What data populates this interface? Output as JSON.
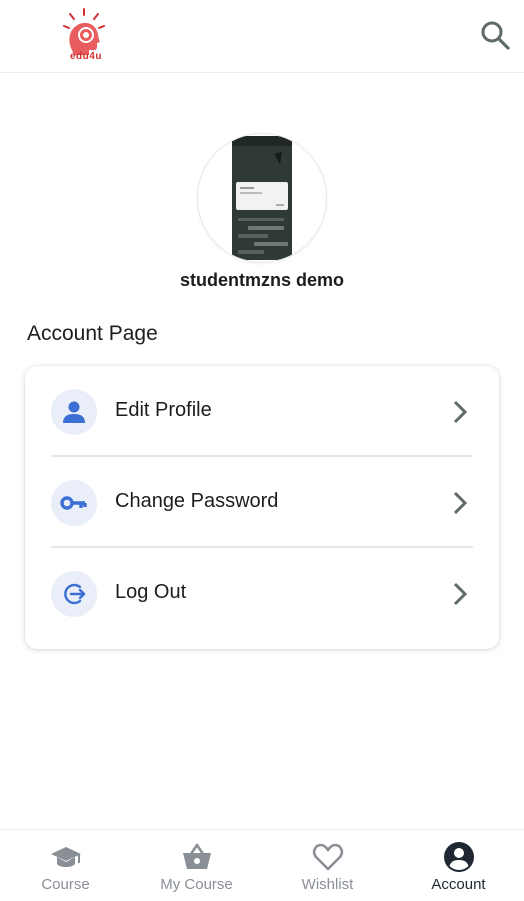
{
  "header": {
    "logo_text": "edu4u",
    "search_icon": "search-icon"
  },
  "profile": {
    "name": "studentmzns demo"
  },
  "section_title": "Account Page",
  "menu": [
    {
      "label": "Edit Profile",
      "icon": "person-icon"
    },
    {
      "label": "Change Password",
      "icon": "key-icon"
    },
    {
      "label": "Log Out",
      "icon": "logout-icon"
    }
  ],
  "bottom_nav": [
    {
      "label": "Course",
      "icon": "graduation-cap-icon",
      "active": false
    },
    {
      "label": "My Course",
      "icon": "basket-icon",
      "active": false
    },
    {
      "label": "Wishlist",
      "icon": "heart-icon",
      "active": false
    },
    {
      "label": "Account",
      "icon": "account-circle-icon",
      "active": true
    }
  ],
  "colors": {
    "accent": "#3b6fd4",
    "icon_bg": "#e9eef9",
    "logo": "#d32f2f",
    "nav_inactive": "#8a8f96",
    "nav_active": "#1f2733"
  }
}
